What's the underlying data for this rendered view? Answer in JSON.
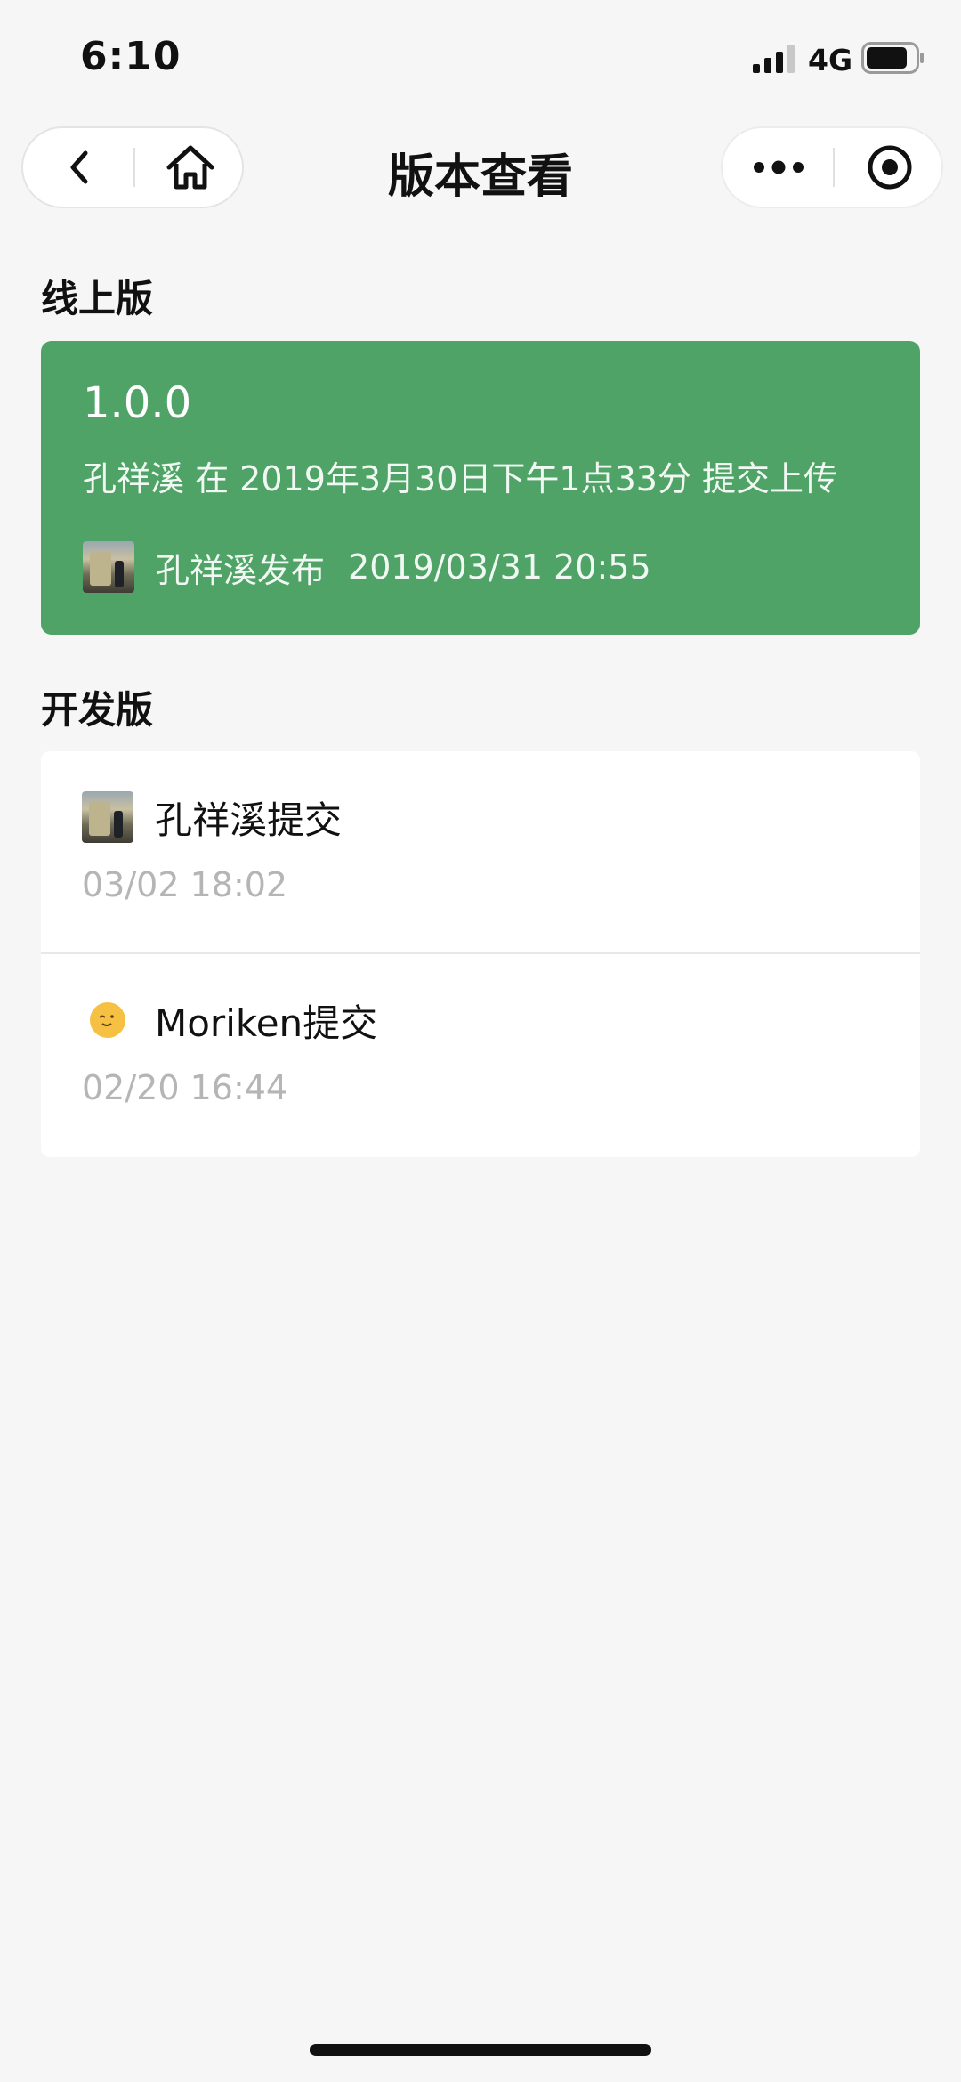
{
  "status_bar": {
    "time": "6:10",
    "network": "4G"
  },
  "nav": {
    "title": "版本查看"
  },
  "online_section": {
    "title": "线上版",
    "version": "1.0.0",
    "commit_info": "孔祥溪 在 2019年3月30日下午1点33分 提交上传",
    "publisher": "孔祥溪发布",
    "publish_time": "2019/03/31 20:55",
    "card_color": "#4fa366"
  },
  "dev_section": {
    "title": "开发版",
    "items": [
      {
        "name": "孔祥溪提交",
        "time": "03/02 18:02",
        "avatar": "photo-avatar"
      },
      {
        "name": "Moriken提交",
        "time": "02/20 16:44",
        "avatar": "smiley-avatar"
      }
    ]
  }
}
